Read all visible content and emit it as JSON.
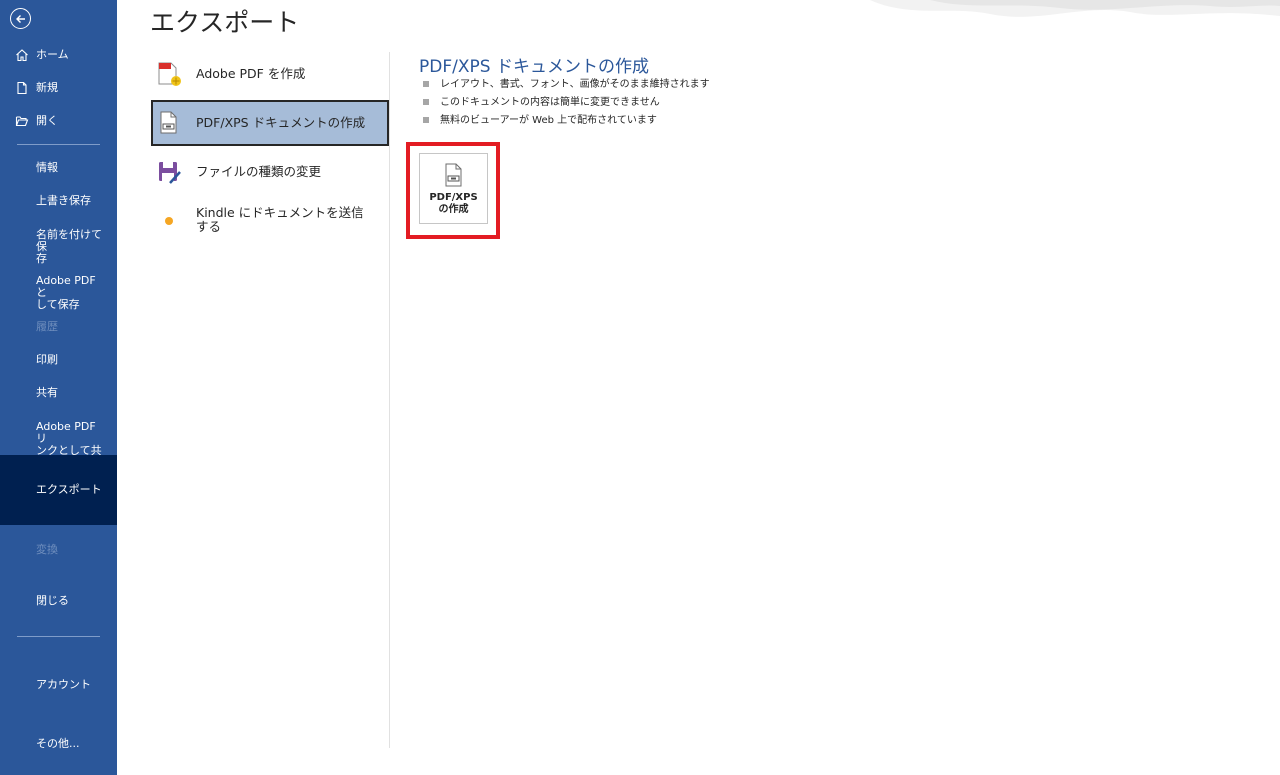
{
  "sidebar": {
    "home": "ホーム",
    "new": "新規",
    "open": "開く",
    "info": "情報",
    "save": "上書き保存",
    "save_as": "名前を付けて保\n存",
    "save_adobe_pdf": "Adobe PDF と\nして保存",
    "history": "履歴",
    "print": "印刷",
    "share": "共有",
    "share_adobe_pdf": "Adobe PDF リ\nンクとして共有",
    "export": "エクスポート",
    "transform": "変換",
    "close": "閉じる",
    "account": "アカウント",
    "more": "その他..."
  },
  "page": {
    "title": "エクスポート"
  },
  "options": [
    {
      "label": "Adobe PDF を作成"
    },
    {
      "label": "PDF/XPS ドキュメントの作成"
    },
    {
      "label": "ファイルの種類の変更"
    },
    {
      "label": "Kindle にドキュメントを送信\nする"
    }
  ],
  "detail": {
    "title": "PDF/XPS ドキュメントの作成",
    "bullets": [
      "レイアウト、書式、フォント、画像がそのまま維持されます",
      "このドキュメントの内容は簡単に変更できません",
      "無料のビューアーが Web 上で配布されています"
    ],
    "button_label": "PDF/XPS\nの作成"
  },
  "colors": {
    "sidebar": "#2b579a",
    "sidebar_selected": "#002050",
    "accent": "#2b579a",
    "highlight": "#e31c23",
    "selected_option": "#a6bcd8"
  }
}
